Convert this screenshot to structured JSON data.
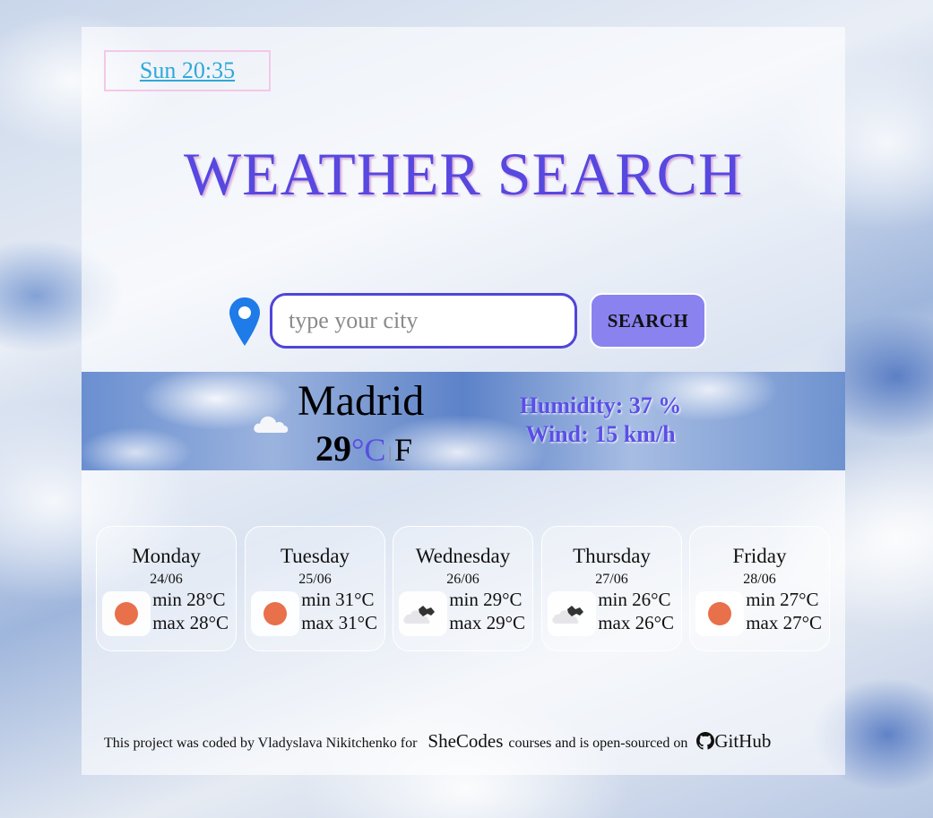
{
  "header": {
    "datetime": "Sun 20:35",
    "title": "WEATHER SEARCH"
  },
  "search": {
    "placeholder": "type your city",
    "button_label": "SEARCH"
  },
  "current": {
    "city": "Madrid",
    "temperature": "29",
    "unit_c": "°C",
    "unit_sep": "|",
    "unit_f": "F",
    "humidity": "Humidity: 37 %",
    "wind": "Wind: 15 km/h",
    "icon": "cloud-icon"
  },
  "forecast": [
    {
      "day": "Monday",
      "date": "24/06",
      "min": "min 28°C",
      "max": "max 28°C",
      "icon": "sun-icon"
    },
    {
      "day": "Tuesday",
      "date": "25/06",
      "min": "min 31°C",
      "max": "max 31°C",
      "icon": "sun-icon"
    },
    {
      "day": "Wednesday",
      "date": "26/06",
      "min": "min 29°C",
      "max": "max 29°C",
      "icon": "broken-clouds-icon"
    },
    {
      "day": "Thursday",
      "date": "27/06",
      "min": "min 26°C",
      "max": "max 26°C",
      "icon": "broken-clouds-icon"
    },
    {
      "day": "Friday",
      "date": "28/06",
      "min": "min 27°C",
      "max": "max 27°C",
      "icon": "sun-icon"
    }
  ],
  "footer": {
    "text_before": "This project was coded by Vladyslava Nikitchenko for",
    "brand": "SheCodes",
    "text_after": "courses and is open-sourced on",
    "link": "GitHub"
  },
  "colors": {
    "accent": "#5748e0",
    "button": "#8a82ef",
    "link": "#2fa8d8",
    "pin": "#1e7be8",
    "sun": "#e8704a"
  }
}
